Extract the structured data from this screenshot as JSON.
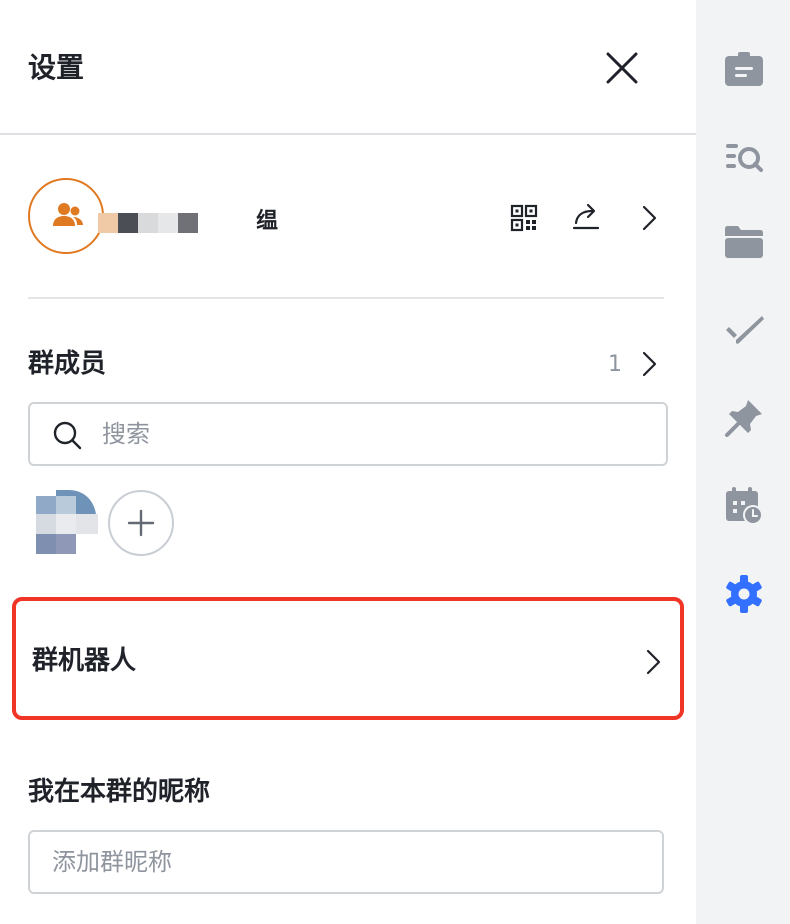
{
  "header": {
    "title": "设置"
  },
  "group": {
    "name_visible_char": "缊"
  },
  "members": {
    "title": "群成员",
    "count": "1",
    "search_placeholder": "搜索"
  },
  "bots": {
    "label": "群机器人"
  },
  "nickname": {
    "title": "我在本群的昵称",
    "placeholder": "添加群昵称",
    "value": ""
  },
  "colors": {
    "accent": "#3370ff",
    "highlight_border": "#f03426",
    "avatar_orange": "#e07a22",
    "rail_icon": "#8f959e"
  },
  "icons": {
    "header": [
      "close-icon"
    ],
    "group_row": [
      "group-icon",
      "qr-code-icon",
      "share-icon",
      "chevron-right-icon"
    ],
    "rail": [
      "announcement-icon",
      "search-history-icon",
      "folder-icon",
      "task-icon",
      "pin-icon",
      "calendar-icon",
      "settings-icon"
    ]
  }
}
